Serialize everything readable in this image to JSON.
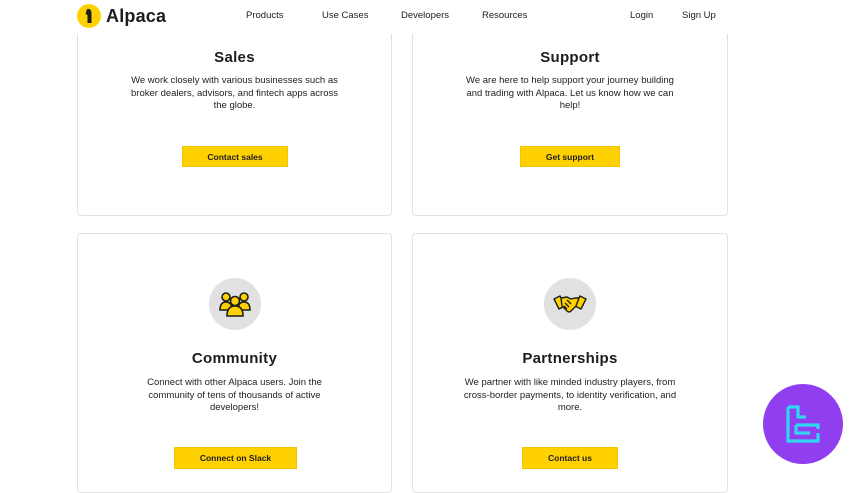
{
  "header": {
    "brand": "Alpaca",
    "nav": [
      "Products",
      "Use Cases",
      "Developers",
      "Resources"
    ],
    "login": "Login",
    "signup": "Sign Up"
  },
  "cards": [
    {
      "title": "Sales",
      "text": "We work closely with various businesses such as broker dealers, advisors, and fintech apps across the globe.",
      "button": "Contact sales"
    },
    {
      "title": "Support",
      "text": "We are here to help support your journey building and trading with Alpaca. Let us know how we can help!",
      "button": "Get support"
    },
    {
      "title": "Community",
      "icon": "people-icon",
      "text": "Connect with other Alpaca users. Join the community of tens of thousands of active developers!",
      "button": "Connect on Slack"
    },
    {
      "title": "Partnerships",
      "icon": "handshake-icon",
      "text": "We partner with like minded industry players, from cross-border payments, to identity verification, and more.",
      "button": "Contact us"
    }
  ],
  "colors": {
    "accent": "#ffd100",
    "badge": "#8f3ef0",
    "icon_bg": "#e1e1e1"
  }
}
